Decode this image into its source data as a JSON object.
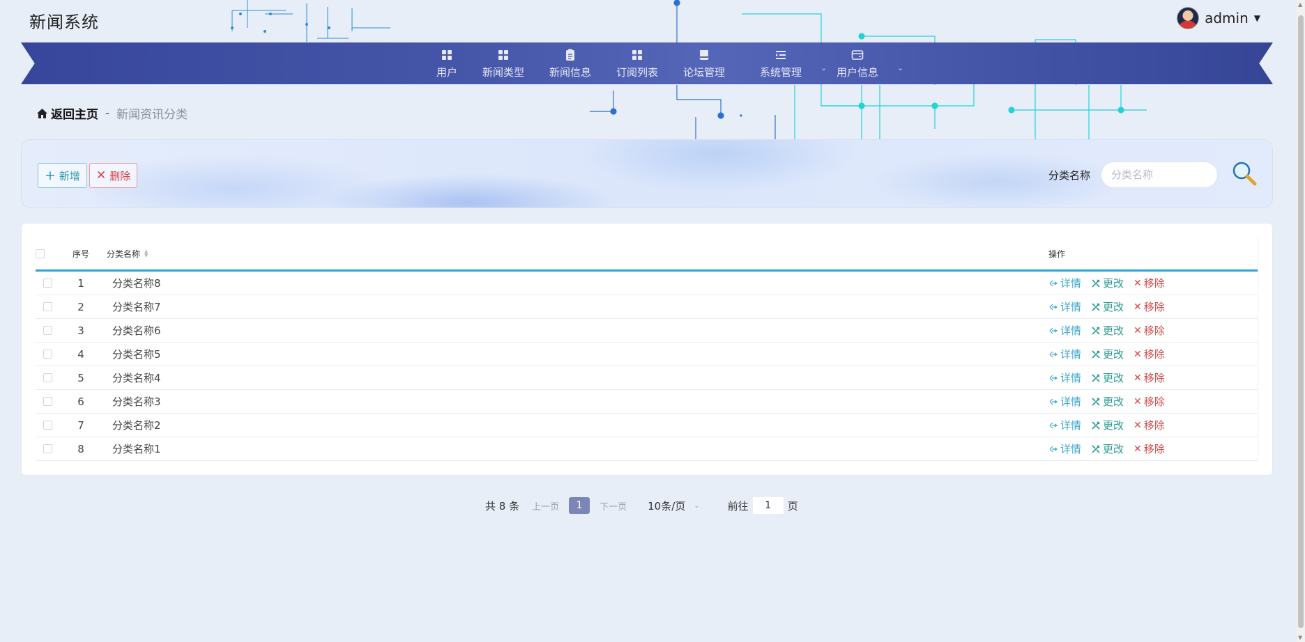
{
  "app": {
    "title": "新闻系统"
  },
  "user": {
    "name": "admin"
  },
  "nav": [
    {
      "label": "用户",
      "icon": "grid-icon"
    },
    {
      "label": "新闻类型",
      "icon": "grid-icon"
    },
    {
      "label": "新闻信息",
      "icon": "clipboard-icon"
    },
    {
      "label": "订阅列表",
      "icon": "grid-icon"
    },
    {
      "label": "论坛管理",
      "icon": "forum-icon"
    },
    {
      "label": "系统管理",
      "icon": "menu-list-icon",
      "dropdown": true
    },
    {
      "label": "用户信息",
      "icon": "card-icon",
      "dropdown": true
    }
  ],
  "breadcrumb": {
    "home": "返回主页",
    "separator": "-",
    "current": "新闻资讯分类"
  },
  "toolbar": {
    "add_label": "新增",
    "delete_label": "删除"
  },
  "search": {
    "label": "分类名称",
    "placeholder": "分类名称",
    "value": ""
  },
  "table": {
    "headers": {
      "index": "序号",
      "name": "分类名称",
      "ops": "操作"
    },
    "rows": [
      {
        "index": "1",
        "name": "分类名称8"
      },
      {
        "index": "2",
        "name": "分类名称7"
      },
      {
        "index": "3",
        "name": "分类名称6"
      },
      {
        "index": "4",
        "name": "分类名称5"
      },
      {
        "index": "5",
        "name": "分类名称4"
      },
      {
        "index": "6",
        "name": "分类名称3"
      },
      {
        "index": "7",
        "name": "分类名称2"
      },
      {
        "index": "8",
        "name": "分类名称1"
      }
    ],
    "ops": {
      "detail": "详情",
      "edit": "更改",
      "remove": "移除"
    }
  },
  "pagination": {
    "total_text": "共 8 条",
    "prev": "上一页",
    "current_page": "1",
    "next": "下一页",
    "page_size": "10条/页",
    "goto_label": "前往",
    "goto_value": "1",
    "page_unit": "页"
  },
  "colors": {
    "nav_bg": "#4253a6",
    "accent": "#27a4dc",
    "add": "#2a9cb3",
    "delete": "#d34141"
  }
}
